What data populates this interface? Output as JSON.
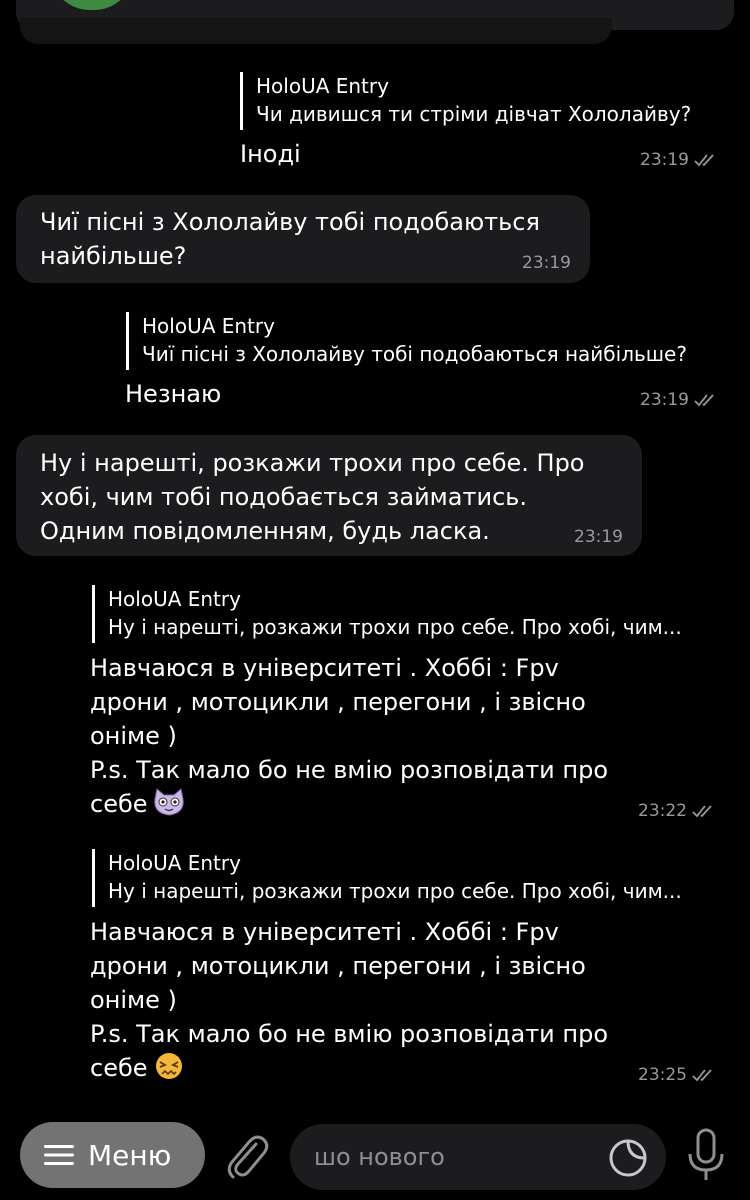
{
  "messages": [
    {
      "id": "m1",
      "reply_to": {
        "name": "HoloUA Entry",
        "text": "Чи дивишся ти стріми дівчат Хололайву?"
      },
      "text": "Іноді",
      "time": "23:19"
    },
    {
      "id": "m2",
      "lines": [
        "Чиї пісні з Хололайву тобі подобаються",
        "найбільше?"
      ],
      "time": "23:19"
    },
    {
      "id": "m3",
      "reply_to": {
        "name": "HoloUA Entry",
        "text": "Чиї пісні з Хололайву тобі подобаються найбільше?"
      },
      "text": "Незнаю",
      "time": "23:19"
    },
    {
      "id": "m4",
      "lines": [
        "Ну і нарешті, розкажи трохи про себе. Про",
        "хобі, чим тобі подобається займатись.",
        "Одним повідомленням, будь ласка."
      ],
      "time": "23:19"
    },
    {
      "id": "m5",
      "reply_to": {
        "name": "HoloUA Entry",
        "text": "Ну і нарешті, розкажи трохи про себе. Про хобі, чим..."
      },
      "lines": [
        "Навчаюся в університеті . Хоббі : Fpv",
        "дрони , мотоцикли , перегони , і звісно",
        "оніме )",
        "P.s. Так мало бо не вмію розповідати про",
        "себе"
      ],
      "emoji": "cat-emoji",
      "time": "23:22"
    },
    {
      "id": "m6",
      "reply_to": {
        "name": "HoloUA Entry",
        "text": "Ну і нарешті, розкажи трохи про себе. Про хобі, чим..."
      },
      "lines": [
        "Навчаюся в університеті . Хоббі : Fpv",
        "дрони , мотоцикли , перегони , і звісно",
        "оніме )",
        "P.s. Так мало бо не вмію розповідати про",
        "себе"
      ],
      "emoji": "confounded-face-emoji",
      "time": "23:25"
    }
  ],
  "bottom_bar": {
    "menu_label": "Меню",
    "input_placeholder": "шо нового",
    "icons": [
      "menu-icon",
      "paperclip-icon",
      "sticker-icon",
      "microphone-icon"
    ]
  },
  "colors": {
    "background": "#000000",
    "incoming_bubble": "#1c1c1e",
    "menu_button": "#737373",
    "meta_text": "#9a9a9e"
  }
}
